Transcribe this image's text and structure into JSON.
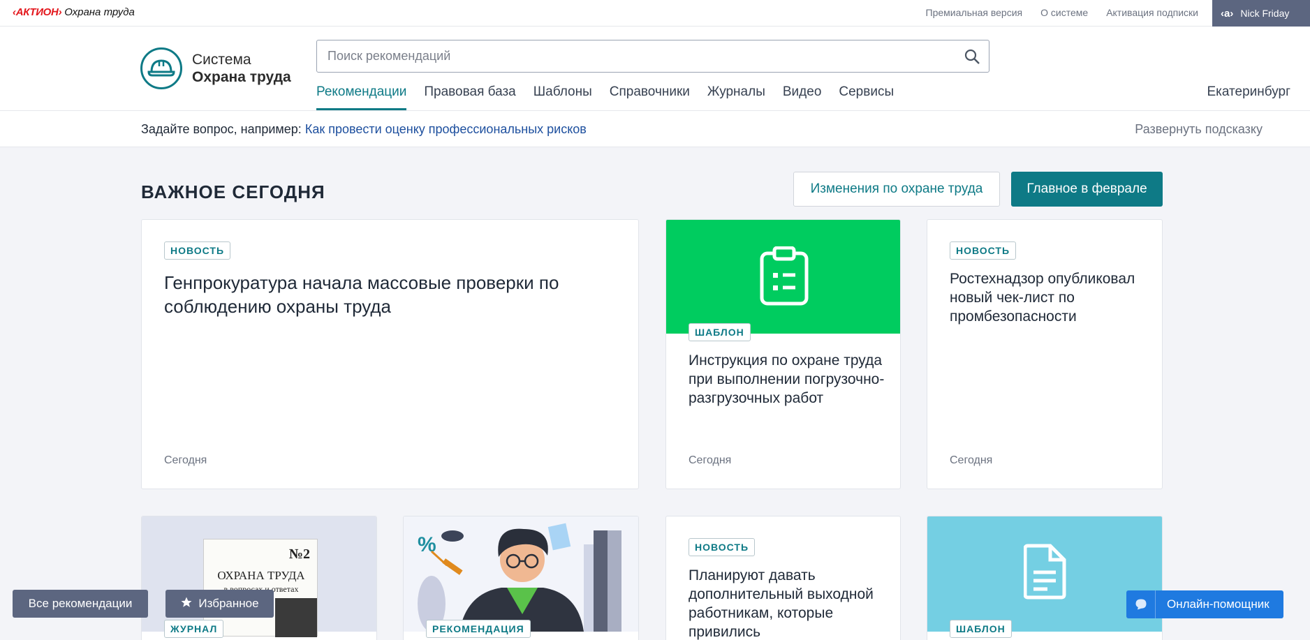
{
  "topbar": {
    "brand_aktion": "‹АКТИОН›",
    "brand_product": "Охрана труда",
    "links": [
      "Премиальная версия",
      "О системе",
      "Активация подписки"
    ],
    "user_logo": "‹a›",
    "user_name": "Nick Friday"
  },
  "header": {
    "logo_line1": "Система",
    "logo_line2": "Охрана труда",
    "search_placeholder": "Поиск рекомендаций",
    "nav": [
      "Рекомендации",
      "Правовая база",
      "Шаблоны",
      "Справочники",
      "Журналы",
      "Видео",
      "Сервисы"
    ],
    "active_nav": "Рекомендации",
    "city": "Екатеринбург"
  },
  "hint": {
    "prefix": "Задайте вопрос, например:",
    "example": "Как провести оценку профессиональных рисков",
    "expand": "Развернуть подсказку"
  },
  "section": {
    "title": "ВАЖНОЕ СЕГОДНЯ",
    "btn_changes": "Изменения по охране труда",
    "btn_main": "Главное в феврале"
  },
  "cards": [
    {
      "badge": "НОВОСТЬ",
      "title": "Генпрокуратура начала массовые проверки по соблюдению охраны труда",
      "date": "Сегодня"
    },
    {
      "badge": "ШАБЛОН",
      "title": "Инструкция по охране труда при выполнении погрузочно-разгрузочных работ",
      "date": "Сегодня",
      "thumb_color": "#00cc5f"
    },
    {
      "badge": "НОВОСТЬ",
      "title": "Ростехнадзор опубликовал новый чек-лист по промбезопасности",
      "date": "Сегодня"
    },
    {
      "badge": "ЖУРНАЛ",
      "thumb_color": "#dfe3ef",
      "journal_title": "ОХРАНА ТРУДА",
      "journal_sub": "в вопросах и ответах",
      "journal_no": "№2"
    },
    {
      "badge": "РЕКОМЕНДАЦИЯ",
      "thumb_color": "#f2f4fa"
    },
    {
      "badge": "НОВОСТЬ",
      "title": "Планируют давать дополнительный выходной работникам, которые привились"
    },
    {
      "badge": "ШАБЛОН",
      "thumb_color": "#74cfe3"
    }
  ],
  "floating": {
    "all_recs": "Все рекомендации",
    "favorites": "Избранное",
    "assistant": "Онлайн-помощник"
  },
  "colors": {
    "accent": "#0e7a86",
    "user_bg": "#5c6680",
    "link": "#1d4f9e",
    "assistant_bg": "#1f7ae0"
  }
}
